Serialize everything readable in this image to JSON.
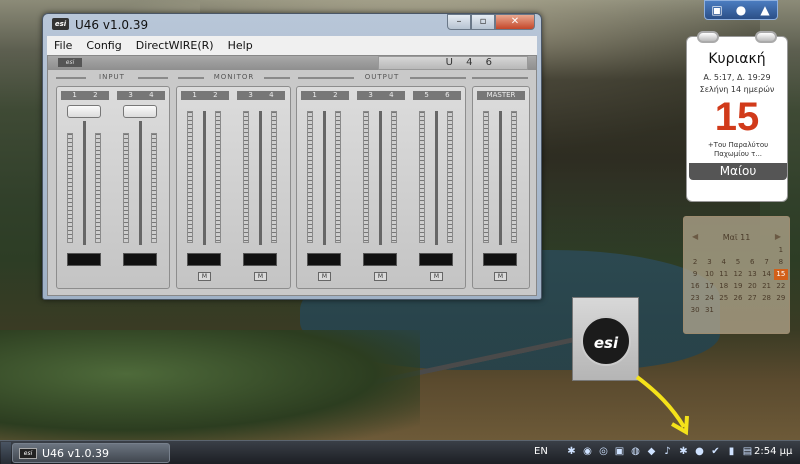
{
  "window": {
    "title": "U46 v1.0.39",
    "app_icon": "esi-logo-icon",
    "controls": [
      "minimize",
      "maximize",
      "close"
    ]
  },
  "menu": [
    "File",
    "Config",
    "DirectWIRE(R)",
    "Help"
  ],
  "mixer": {
    "device_name": "U 4 6",
    "sections": {
      "input": {
        "label": "INPUT",
        "channels": [
          "1  2",
          "3  4"
        ]
      },
      "monitor": {
        "label": "MONITOR",
        "channels": [
          "1  2",
          "3  4"
        ]
      },
      "output": {
        "label": "OUTPUT",
        "channels": [
          "1  2",
          "3  4",
          "5  6"
        ]
      },
      "master": {
        "label": "MASTER"
      }
    },
    "mute_label": "M"
  },
  "calendar_gadget": {
    "weekday": "Κυριακή",
    "sun_line": "Α. 5:17, Δ. 19:29",
    "moon_line": "Σελήνη 14 ημερών",
    "day_number": "15",
    "name_day": "+Του Παραλύτου Παχωμίου τ...",
    "month": "Μαίου"
  },
  "mini_calendar": {
    "month_label": "Μαϊ 11",
    "days": [
      "",
      "",
      "",
      "",
      "",
      "",
      "1",
      "2",
      "3",
      "4",
      "5",
      "6",
      "7",
      "8",
      "9",
      "10",
      "11",
      "12",
      "13",
      "14",
      "15",
      "16",
      "17",
      "18",
      "19",
      "20",
      "21",
      "22",
      "23",
      "24",
      "25",
      "26",
      "27",
      "28",
      "29",
      "30",
      "31",
      "",
      "",
      "",
      "",
      ""
    ],
    "today": "15"
  },
  "taskbar": {
    "item_label": "U46 v1.0.39",
    "language": "EN",
    "clock": "2:54 μμ"
  },
  "colors": {
    "accent_red": "#d13a1a",
    "arrow": "#f4e21a"
  }
}
